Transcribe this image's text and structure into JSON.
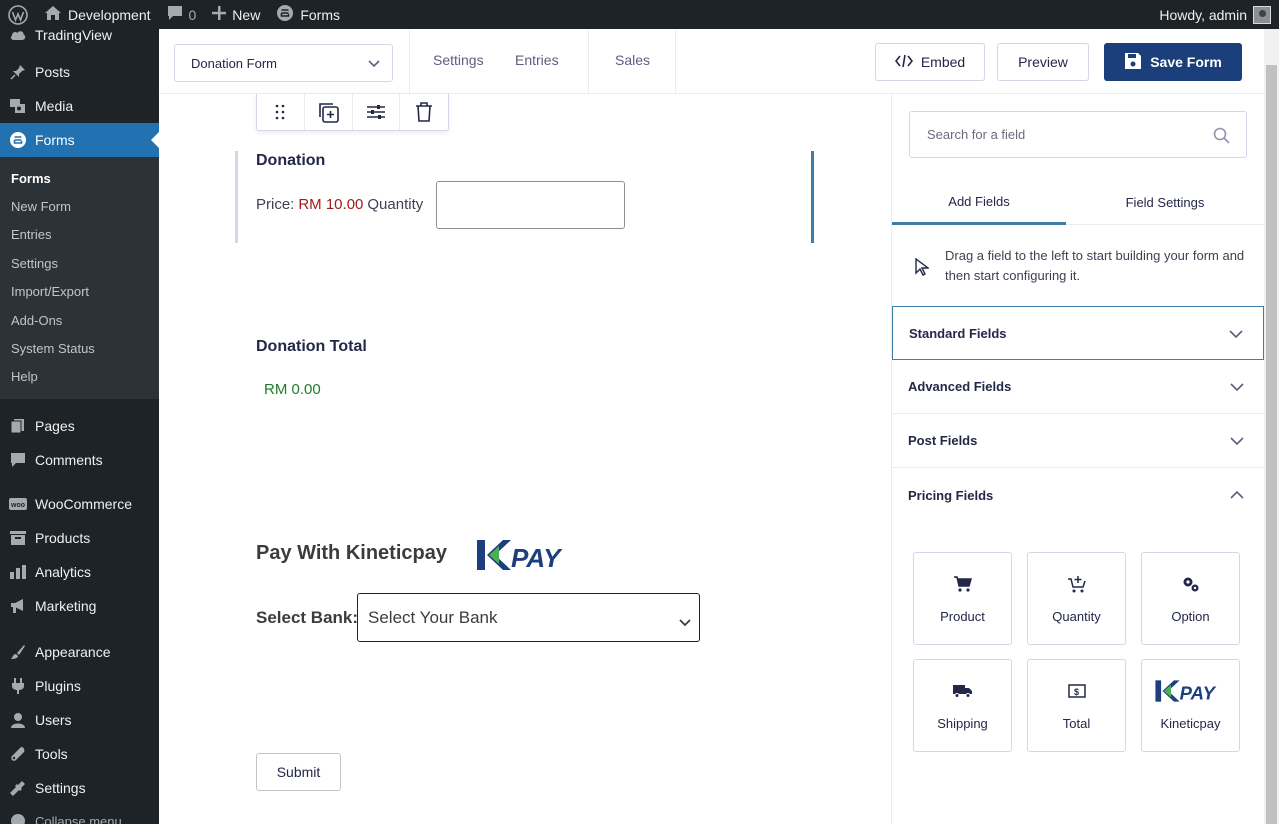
{
  "admin_bar": {
    "site_name": "Development",
    "comments_count": "0",
    "new_label": "New",
    "forms_label": "Forms",
    "howdy": "Howdy, admin"
  },
  "sidebar": {
    "top_item": "TradingView",
    "items_before": [
      {
        "label": "Posts",
        "icon": "pin-icon"
      },
      {
        "label": "Media",
        "icon": "media-icon"
      }
    ],
    "forms_label": "Forms",
    "submenu": [
      "Forms",
      "New Form",
      "Entries",
      "Settings",
      "Import/Export",
      "Add-Ons",
      "System Status",
      "Help"
    ],
    "items_after_1": [
      {
        "label": "Pages",
        "icon": "pages-icon"
      },
      {
        "label": "Comments",
        "icon": "comments-icon"
      }
    ],
    "items_after_2": [
      {
        "label": "WooCommerce",
        "icon": "woo-icon"
      },
      {
        "label": "Products",
        "icon": "products-icon"
      },
      {
        "label": "Analytics",
        "icon": "analytics-icon"
      },
      {
        "label": "Marketing",
        "icon": "marketing-icon"
      }
    ],
    "items_after_3": [
      {
        "label": "Appearance",
        "icon": "appearance-icon"
      },
      {
        "label": "Plugins",
        "icon": "plugins-icon"
      },
      {
        "label": "Users",
        "icon": "users-icon"
      },
      {
        "label": "Tools",
        "icon": "tools-icon"
      },
      {
        "label": "Settings",
        "icon": "settings-icon"
      }
    ],
    "collapse": "Collapse menu"
  },
  "toolbar": {
    "form_select_value": "Donation Form",
    "settings": "Settings",
    "entries": "Entries",
    "sales": "Sales",
    "embed": "Embed",
    "preview": "Preview",
    "save": "Save Form",
    "save_color": "#1a3f7a"
  },
  "canvas": {
    "donation_label": "Donation",
    "price_prefix": "Price:",
    "price_value": "RM 10.00",
    "quantity_label": "Quantity",
    "donation_total_label": "Donation Total",
    "total_value": "RM 0.00",
    "pay_title": "Pay With Kineticpay",
    "select_bank_label": "Select Bank:",
    "select_bank_value": "Select Your Bank",
    "submit": "Submit",
    "price_color": "#a31a1a",
    "total_color": "#1d7d2a"
  },
  "panel": {
    "search_placeholder": "Search for a field",
    "tab_add": "Add Fields",
    "tab_settings": "Field Settings",
    "drag_hint": "Drag a field to the left to start building your form and then start configuring it.",
    "sections": [
      "Standard Fields",
      "Advanced Fields",
      "Post Fields",
      "Pricing Fields"
    ],
    "pricing_fields": [
      "Product",
      "Quantity",
      "Option",
      "Shipping",
      "Total",
      "Kineticpay"
    ]
  }
}
